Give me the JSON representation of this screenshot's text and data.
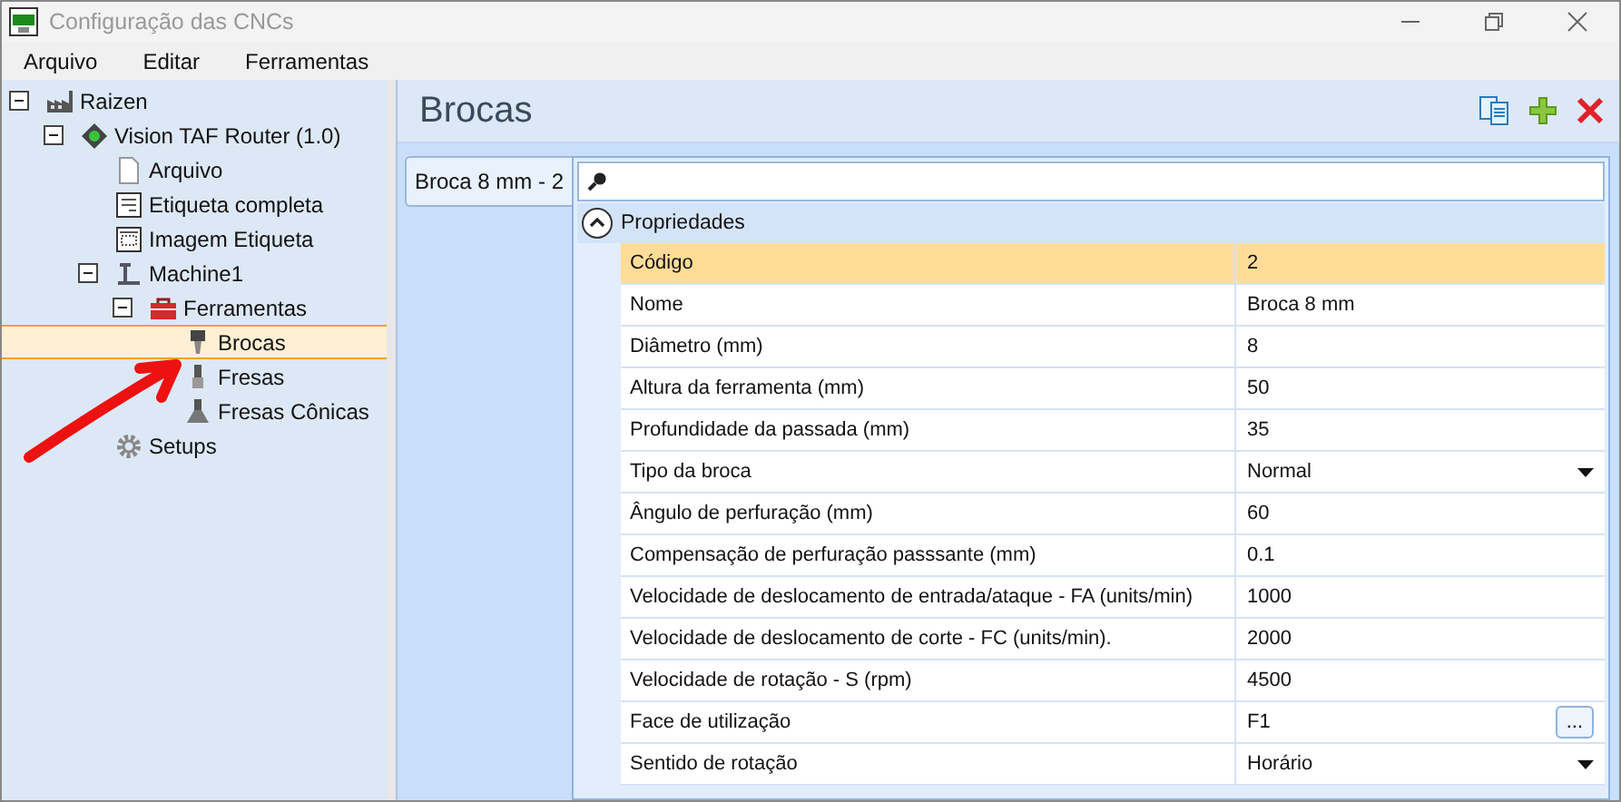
{
  "window": {
    "title": "Configuração das CNCs"
  },
  "menu": [
    "Arquivo",
    "Editar",
    "Ferramentas"
  ],
  "tree": [
    {
      "label": "Raizen",
      "kind": "factory",
      "expanded": true,
      "selected": false,
      "children": [
        {
          "label": "Vision TAF Router (1.0)",
          "kind": "router",
          "expanded": true,
          "selected": false,
          "children": [
            {
              "label": "Arquivo",
              "kind": "file",
              "selected": false
            },
            {
              "label": "Etiqueta completa",
              "kind": "label",
              "selected": false
            },
            {
              "label": "Imagem Etiqueta",
              "kind": "image",
              "selected": false
            },
            {
              "label": "Machine1",
              "kind": "machine",
              "expanded": true,
              "selected": false,
              "children": [
                {
                  "label": "Ferramentas",
                  "kind": "toolbox",
                  "expanded": true,
                  "selected": false,
                  "children": [
                    {
                      "label": "Brocas",
                      "kind": "drill",
                      "selected": true
                    },
                    {
                      "label": "Fresas",
                      "kind": "mill",
                      "selected": false
                    },
                    {
                      "label": "Fresas Cônicas",
                      "kind": "cone",
                      "selected": false
                    }
                  ]
                }
              ]
            },
            {
              "label": "Setups",
              "kind": "gear",
              "selected": false
            }
          ]
        }
      ]
    }
  ],
  "panel": {
    "title": "Brocas"
  },
  "items": [
    {
      "label": "Broca 8 mm - 2",
      "selected": true
    }
  ],
  "properties": {
    "group": "Propriedades",
    "expanded": true,
    "rows": [
      {
        "name": "Código",
        "value": "2",
        "kind": "text",
        "selected": true
      },
      {
        "name": "Nome",
        "value": "Broca 8 mm",
        "kind": "text",
        "selected": false
      },
      {
        "name": "Diâmetro (mm)",
        "value": "8",
        "kind": "text",
        "selected": false
      },
      {
        "name": "Altura da ferramenta (mm)",
        "value": "50",
        "kind": "text",
        "selected": false
      },
      {
        "name": "Profundidade da passada (mm)",
        "value": "35",
        "kind": "text",
        "selected": false
      },
      {
        "name": "Tipo da broca",
        "value": "Normal",
        "kind": "dropdown",
        "selected": false
      },
      {
        "name": "Ângulo de perfuração (mm)",
        "value": "60",
        "kind": "text",
        "selected": false
      },
      {
        "name": "Compensação de perfuração passsante (mm)",
        "value": "0.1",
        "kind": "text",
        "selected": false
      },
      {
        "name": "Velocidade de deslocamento de entrada/ataque - FA (units/min)",
        "value": "1000",
        "kind": "text",
        "selected": false
      },
      {
        "name": "Velocidade de deslocamento de corte - FC (units/min).",
        "value": "2000",
        "kind": "text",
        "selected": false
      },
      {
        "name": "Velocidade de rotação - S (rpm)",
        "value": "4500",
        "kind": "text",
        "selected": false
      },
      {
        "name": "Face de utilização",
        "value": "F1",
        "kind": "ellipsis",
        "button": "...",
        "selected": false
      },
      {
        "name": "Sentido de rotação",
        "value": "Horário",
        "kind": "dropdown",
        "selected": false
      }
    ]
  }
}
